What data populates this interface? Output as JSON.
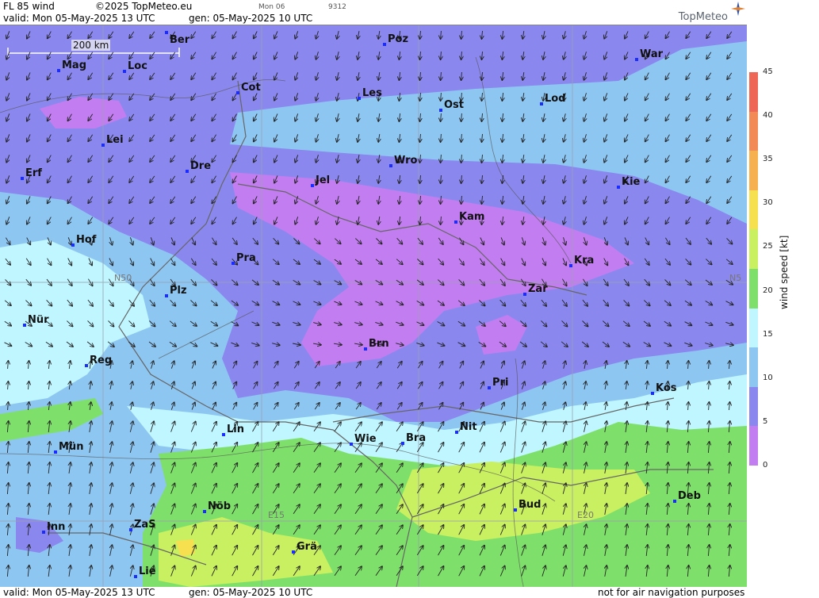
{
  "header": {
    "product": "FL 85 wind",
    "copyright": "©2025 TopMeteo.eu",
    "valid": "valid:  Mon  05-May-2025  13 UTC",
    "gen": "gen: 05-May-2025 10 UTC",
    "tab_mon06": "Mon 06",
    "tab_code": "9312",
    "logo": "TopMeteo"
  },
  "footer": {
    "valid": "valid:  Mon  05-May-2025  13 UTC",
    "gen": "gen: 05-May-2025 10 UTC",
    "disclaimer": "not for air navigation purposes"
  },
  "scale_label": "200 km",
  "grid_labels": {
    "n50_left": "N50",
    "n50_right": "N5",
    "e15": "E15",
    "e20": "E20"
  },
  "legend": {
    "title": "wind  speed  [kt]",
    "ticks": [
      "45",
      "40",
      "35",
      "30",
      "25",
      "20",
      "15",
      "10",
      "5",
      "0"
    ],
    "colors": [
      "#ee6655",
      "#f28a55",
      "#f6b050",
      "#f6e050",
      "#c8f060",
      "#7ee06a",
      "#bff6ff",
      "#8ec6f2",
      "#8a88ee",
      "#c27ef0"
    ]
  },
  "cities": [
    {
      "name": "Ber"
    },
    {
      "name": "Poz"
    },
    {
      "name": "War"
    },
    {
      "name": "Mag"
    },
    {
      "name": "Loc"
    },
    {
      "name": "Cot"
    },
    {
      "name": "Les"
    },
    {
      "name": "Lod"
    },
    {
      "name": "Ost"
    },
    {
      "name": "Lei"
    },
    {
      "name": "Dre"
    },
    {
      "name": "Wro"
    },
    {
      "name": "Erf"
    },
    {
      "name": "Jel"
    },
    {
      "name": "Kie"
    },
    {
      "name": "Kam"
    },
    {
      "name": "Hof"
    },
    {
      "name": "Pra"
    },
    {
      "name": "Kra"
    },
    {
      "name": "Plz"
    },
    {
      "name": "Zar"
    },
    {
      "name": "Nür"
    },
    {
      "name": "Brn"
    },
    {
      "name": "Reg"
    },
    {
      "name": "Pri"
    },
    {
      "name": "Kos"
    },
    {
      "name": "Lin"
    },
    {
      "name": "Nit"
    },
    {
      "name": "Mün"
    },
    {
      "name": "Wie"
    },
    {
      "name": "Bra"
    },
    {
      "name": "Deb"
    },
    {
      "name": "Nöb"
    },
    {
      "name": "Bud"
    },
    {
      "name": "Inn"
    },
    {
      "name": "ZaS"
    },
    {
      "name": "Grä"
    },
    {
      "name": "Lie"
    }
  ]
}
